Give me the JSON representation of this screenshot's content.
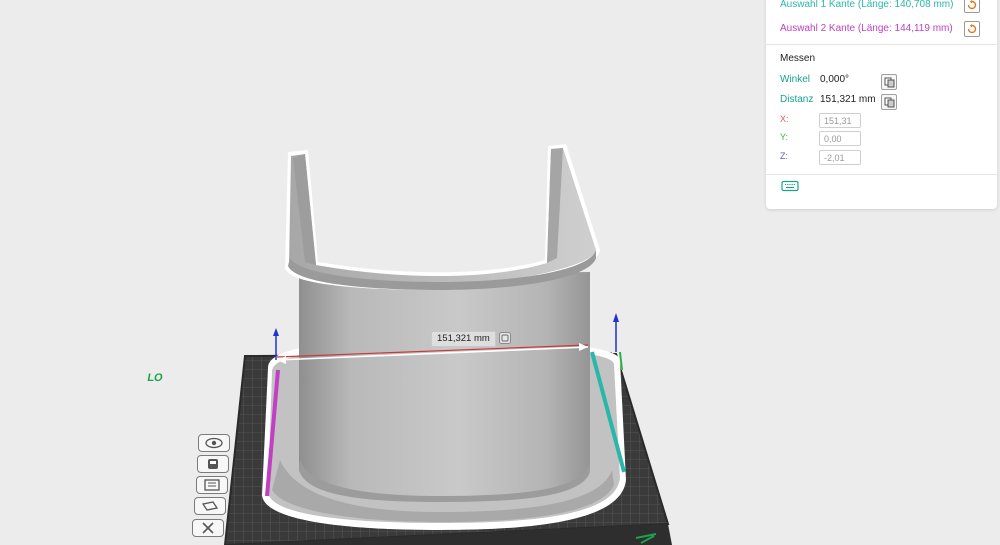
{
  "selection": {
    "first": {
      "prefix": "Auswahl 1",
      "desc": "Kante (Länge: 140,708 mm)",
      "color": "#2ab7a9"
    },
    "second": {
      "prefix": "Auswahl 2",
      "desc": "Kante (Länge: 144,119 mm)",
      "color": "#c03fc2"
    }
  },
  "measure": {
    "heading": "Messen",
    "angle_label": "Winkel",
    "angle_value": "0,000°",
    "distance_label": "Distanz",
    "distance_value": "151,321 mm",
    "x_label": "X:",
    "x_value": "151,31",
    "y_label": "Y:",
    "y_value": "0,00",
    "z_label": "Z:",
    "z_value": "-2,01"
  },
  "viewport": {
    "dimension_label": "151,321 mm",
    "plate_text": "LO"
  },
  "colors": {
    "accent": "#1aa08c",
    "selection1": "#2ab7a9",
    "selection2": "#c03fc2",
    "axis_x": "#e23b3b",
    "axis_y": "#2bb34a",
    "axis_z": "#2233cc",
    "reset_icon": "#e07a1f"
  },
  "icons": {
    "reset": "reset-icon",
    "copy": "copy-icon",
    "keyboard": "keyboard-icon",
    "toolbar": [
      "eye-icon",
      "cube-icon",
      "plate-stack-icon",
      "layers-icon",
      "close-icon"
    ]
  }
}
